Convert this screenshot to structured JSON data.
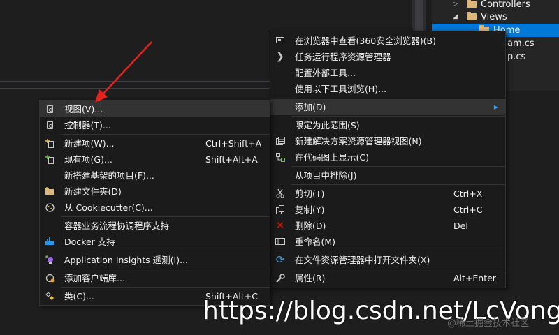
{
  "explorer": {
    "items": [
      {
        "label": "Controllers",
        "type": "folder",
        "expanded": false
      },
      {
        "label": "Views",
        "type": "folder",
        "expanded": true
      },
      {
        "label": "Home",
        "type": "folder",
        "selected": true
      },
      {
        "label": "am.cs",
        "type": "file"
      },
      {
        "label": "p.cs",
        "type": "file"
      }
    ]
  },
  "left_menu": {
    "items": [
      {
        "icon": "view-icon",
        "label": "视图(V)...",
        "shortcut": ""
      },
      {
        "icon": "controller-icon",
        "label": "控制器(T)...",
        "shortcut": ""
      },
      {
        "icon": "new-item-icon",
        "label": "新建项(W)...",
        "shortcut": "Ctrl+Shift+A"
      },
      {
        "icon": "existing-item-icon",
        "label": "现有项(G)...",
        "shortcut": "Shift+Alt+A"
      },
      {
        "icon": "",
        "label": "新搭建基架的项目(F)...",
        "shortcut": ""
      },
      {
        "icon": "new-folder-icon",
        "label": "新建文件夹(D)",
        "shortcut": ""
      },
      {
        "icon": "cookiecutter-icon",
        "label": "从 Cookiecutter(C)...",
        "shortcut": ""
      },
      {
        "icon": "",
        "label": "容器业务流程协调程序支持",
        "shortcut": ""
      },
      {
        "icon": "docker-icon",
        "label": "Docker 支持",
        "shortcut": ""
      },
      {
        "icon": "insights-icon",
        "label": "Application Insights 遥测(I)...",
        "shortcut": ""
      },
      {
        "icon": "client-library-icon",
        "label": "添加客户端库...",
        "shortcut": ""
      },
      {
        "icon": "class-icon",
        "label": "类(C)...",
        "shortcut": "Shift+Alt+C"
      }
    ]
  },
  "right_menu": {
    "items": [
      {
        "icon": "browser-icon",
        "label": "在浏览器中查看(360安全浏览器)(B)",
        "shortcut": ""
      },
      {
        "icon": "chevron-right-icon",
        "label": "任务运行程序资源管理器",
        "shortcut": ""
      },
      {
        "icon": "",
        "label": "配置外部工具...",
        "shortcut": ""
      },
      {
        "icon": "",
        "label": "使用以下工具浏览(H)...",
        "shortcut": ""
      },
      {
        "icon": "",
        "label": "添加(D)",
        "shortcut": "",
        "submenu": true
      },
      {
        "icon": "",
        "label": "限定为此范围(S)",
        "shortcut": ""
      },
      {
        "icon": "solution-view-icon",
        "label": "新建解决方案资源管理器视图(N)",
        "shortcut": ""
      },
      {
        "icon": "code-map-icon",
        "label": "在代码图上显示(C)",
        "shortcut": ""
      },
      {
        "icon": "",
        "label": "从项目中排除(J)",
        "shortcut": ""
      },
      {
        "icon": "cut-icon",
        "label": "剪切(T)",
        "shortcut": "Ctrl+X"
      },
      {
        "icon": "copy-icon",
        "label": "复制(Y)",
        "shortcut": "Ctrl+C"
      },
      {
        "icon": "delete-icon",
        "label": "删除(D)",
        "shortcut": "Del"
      },
      {
        "icon": "rename-icon",
        "label": "重命名(M)",
        "shortcut": ""
      },
      {
        "icon": "refresh-icon",
        "label": "在文件资源管理器中打开文件夹(X)",
        "shortcut": ""
      },
      {
        "icon": "wrench-icon",
        "label": "属性(R)",
        "shortcut": "Alt+Enter"
      }
    ]
  },
  "watermark": {
    "url": "https://blog.csdn.net/LcVong",
    "secondary": "@稀土掘金技术社区"
  },
  "colors": {
    "background": "#1e1e1e",
    "menu": "#1b1b1c",
    "selection": "#0078d7",
    "delete_red": "#e51400",
    "arrow_red": "#e8211a"
  }
}
